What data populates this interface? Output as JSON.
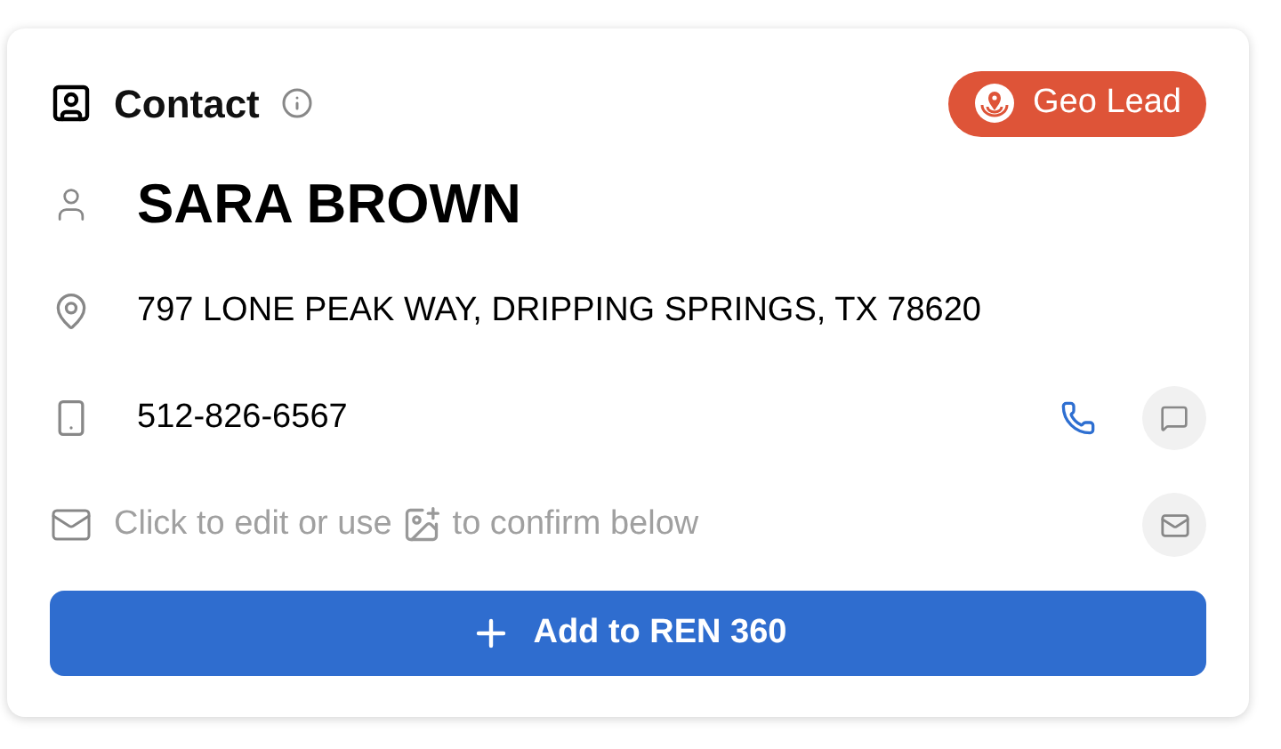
{
  "card": {
    "title": "Contact",
    "badge": "Geo Lead"
  },
  "name": "SARA BROWN",
  "address": "797 LONE PEAK WAY, DRIPPING SPRINGS, TX 78620",
  "phone": "512-826-6567",
  "email": {
    "hint_before": "Click to edit or use",
    "hint_after": "to confirm below"
  },
  "button": "Add to REN 360"
}
